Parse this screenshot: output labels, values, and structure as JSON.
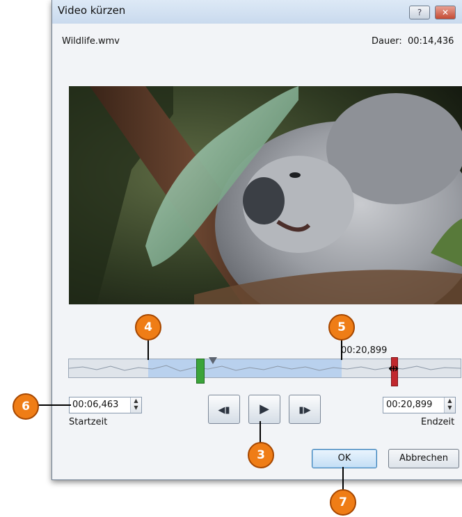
{
  "dialog": {
    "title": "Video kürzen",
    "help_glyph": "?",
    "close_glyph": "✕"
  },
  "info": {
    "filename": "Wildlife.wmv",
    "duration_label": "Dauer:",
    "duration_value": "00:14,436"
  },
  "trim": {
    "current_time": "00:20,899",
    "start_value": "00:06,463",
    "start_label": "Startzeit",
    "end_value": "00:20,899",
    "end_label": "Endzeit",
    "spin_up": "▲",
    "spin_down": "▼"
  },
  "playback": {
    "prev_frame_glyph": "◀▮",
    "play_glyph": "▶",
    "next_frame_glyph": "▮▶"
  },
  "buttons": {
    "ok": "OK",
    "cancel": "Abbrechen"
  },
  "callouts": [
    "3",
    "4",
    "5",
    "6",
    "7"
  ],
  "colors": {
    "callout": "#ef7d16",
    "start_marker": "#3ba43a",
    "end_marker": "#c1272d",
    "selection": "#b9d1ee"
  }
}
